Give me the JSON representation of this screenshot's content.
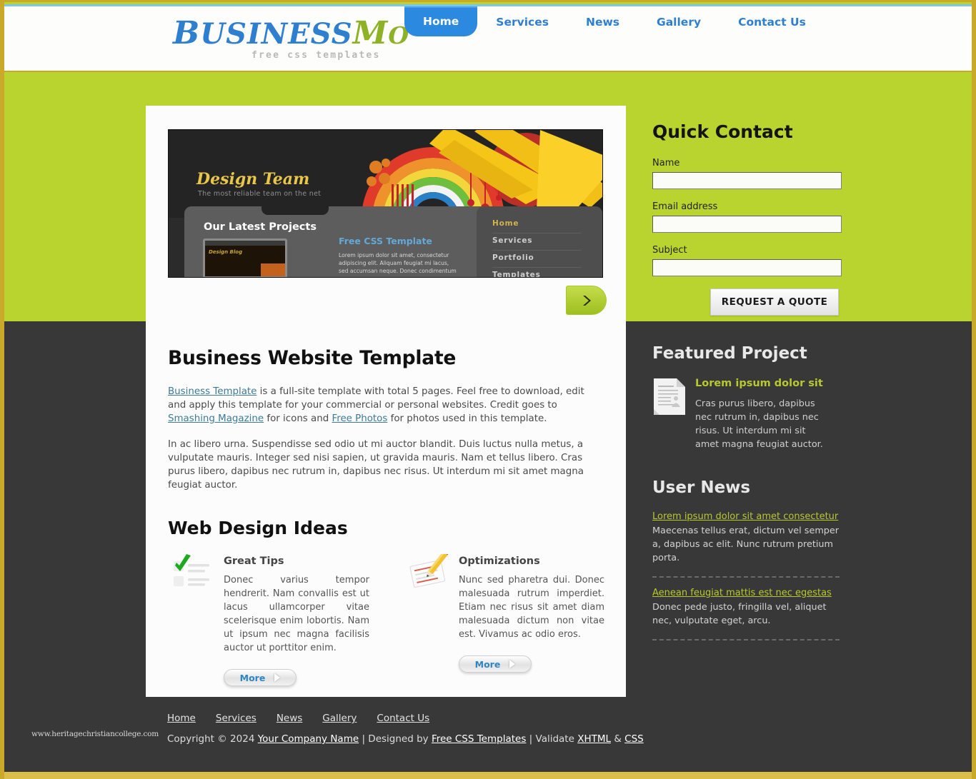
{
  "brand": {
    "name_part1": "B",
    "name_part2": "USINESS",
    "name_part3": "M",
    "name_part4": "O",
    "tagline": "free css templates",
    "color_blue": "#2f7fd0",
    "color_green": "#8db226"
  },
  "nav": {
    "items": [
      {
        "label": "Home",
        "active": true
      },
      {
        "label": "Services",
        "active": false
      },
      {
        "label": "News",
        "active": false
      },
      {
        "label": "Gallery",
        "active": false
      },
      {
        "label": "Contact Us",
        "active": false
      }
    ]
  },
  "hero": {
    "title": "Design Team",
    "subtitle": "The most reliable team on the net",
    "panel_heading": "Our Latest Projects",
    "thumb_label": "Design Blog",
    "article_title": "Free CSS Template",
    "article_body": "Lorem ipsum dolor sit amet, consectetur adipiscing elit. Aliquam feugiat mi lacus, sed accumsan neque. Donec condimentum",
    "menu": [
      "Home",
      "Services",
      "Portfolio",
      "Templates"
    ],
    "next_label": "next-slide"
  },
  "quick_contact": {
    "title": "Quick Contact",
    "fields": [
      {
        "label": "Name",
        "value": "",
        "placeholder": ""
      },
      {
        "label": "Email address",
        "value": "",
        "placeholder": ""
      },
      {
        "label": "Subject",
        "value": "",
        "placeholder": ""
      }
    ],
    "submit_label": "REQUEST A QUOTE"
  },
  "main": {
    "title": "Business Website Template",
    "paragraph1": {
      "link1": "Business Template",
      "text1": " is a full-site template with total 5 pages. Feel free to download, edit and apply this template for your commercial or personal websites. Credit goes to ",
      "link2": "Smashing Magazine",
      "text2": " for icons and ",
      "link3": "Free Photos",
      "text3": " for photos used in this template."
    },
    "paragraph2": "In ac libero urna. Suspendisse sed odio ut mi auctor blandit. Duis luctus nulla metus, a vulputate mauris. Integer sed nisi sapien, ut gravida mauris. Nam et tellus libero. Cras purus libero, dapibus nec rutrum in, dapibus nec risus. Ut interdum mi sit amet magna feugiat auctor.",
    "ideas_title": "Web Design Ideas",
    "ideas": [
      {
        "icon": "green-check-list-icon",
        "heading": "Great Tips",
        "body": "Donec varius tempor hendrerit. Nam convallis est ut lacus ullamcorper vitae scelerisque enim lobortis. Nam ut ipsum nec magna facilisis auctor ut porttitor enim.",
        "more_label": "More"
      },
      {
        "icon": "pencil-paper-icon",
        "heading": "Optimizations",
        "body": "Nunc sed pharetra dui. Donec malesuada rutrum imperdiet. Etiam nec risus sit amet diam malesuada dictum non vitae est. Vivamus ac odio eros.",
        "more_label": "More"
      }
    ]
  },
  "featured": {
    "title": "Featured Project",
    "icon": "document-icon",
    "heading": "Lorem ipsum dolor sit",
    "body": "Cras purus libero, dapibus nec rutrum in, dapibus nec risus. Ut interdum mi sit amet magna feugiat auctor."
  },
  "user_news": {
    "title": "User News",
    "items": [
      {
        "link": "Lorem ipsum dolor sit amet consectetur",
        "body": "Maecenas tellus erat, dictum vel semper a, dapibus ac elit. Nunc rutrum pretium porta."
      },
      {
        "link": "Aenean feugiat mattis est nec egestas",
        "body": "Donec pede justo, fringilla vel, aliquet nec, vulputate eget, arcu."
      }
    ]
  },
  "footer": {
    "nav": [
      "Home",
      "Services",
      "News",
      "Gallery",
      "Contact Us"
    ],
    "copyright_pre": "Copyright © 2024 ",
    "company": "Your Company Name",
    "designed_by_pre": " | Designed by ",
    "designer": "Free CSS Templates",
    "validate_pre": " | Validate ",
    "xhtml": "XHTML",
    "amp": " & ",
    "css": "CSS",
    "watermark": "www.heritagechristiancollege.com"
  },
  "theme": {
    "green": "#b9d42e",
    "gold": "#c9a82a",
    "blue": "#2b8ae0",
    "dark": "#383838",
    "accent_olive": "#b8c82f"
  }
}
